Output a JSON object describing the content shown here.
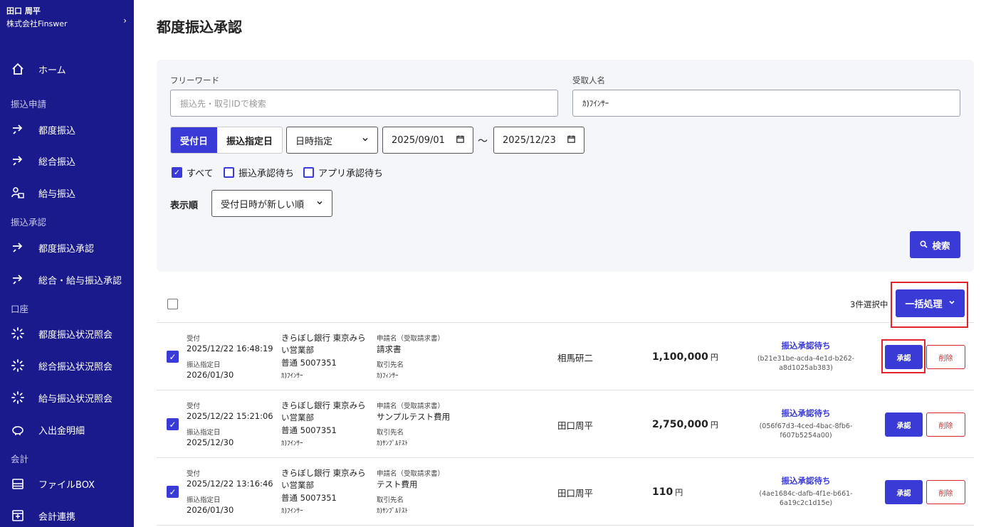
{
  "sidebar": {
    "user_name": "田口 周平",
    "company": "株式会社Finswer",
    "home": "ホーム",
    "section_transfer": "振込申請",
    "item_single": "都度振込",
    "item_bulk": "総合振込",
    "item_salary": "給与振込",
    "section_approval": "振込承認",
    "item_single_approval": "都度振込承認",
    "item_bulk_salary_approval": "総合・給与振込承認",
    "section_account": "口座",
    "item_single_status": "都度振込状況照会",
    "item_bulk_status": "総合振込状況照会",
    "item_salary_status": "給与振込状況照会",
    "item_statement": "入出金明細",
    "section_accounting": "会計",
    "item_filebox": "ファイルBOX",
    "item_accounting_link": "会計連携"
  },
  "page_title": "都度振込承認",
  "filter": {
    "freeword_label": "フリーワード",
    "freeword_placeholder": "振込先・取引IDで検索",
    "recipient_label": "受取人名",
    "recipient_value": "ｶ)ﾌｲﾝｻｰ",
    "seg_received": "受付日",
    "seg_designated": "振込指定日",
    "period_select": "日時指定",
    "date_from": "2025/09/01",
    "tilde": "〜",
    "date_to": "2025/12/23",
    "cb_all": "すべて",
    "cb_transfer_wait": "振込承認待ち",
    "cb_app_wait": "アプリ承認待ち",
    "sort_label": "表示順",
    "sort_value": "受付日時が新しい順",
    "search_button": "検索"
  },
  "list": {
    "selected_count": "3件選択中",
    "bulk_button": "一括処理",
    "rows": [
      {
        "received_label": "受付",
        "received": "2025/12/22 16:48:19",
        "designated_label": "振込指定日",
        "designated": "2026/01/30",
        "bank_line1": "きらぼし銀行 東京みら",
        "bank_line2": "い営業部",
        "account": "普通 5007351",
        "account_name": "ｶ)ﾌｲﾝｻｰ",
        "request_label": "申請名（受取請求書）",
        "request": "請求書",
        "partner_label": "取引先名",
        "partner": "ｶ)ﾌｨﾝｻｰ",
        "applicant": "相馬研二",
        "amount": "1,100,000",
        "yen": "円",
        "status": "振込承認待ち",
        "txid": "(b21e31be-acda-4e1d-b262-a8d1025ab383)",
        "approve": "承認",
        "delete": "削除"
      },
      {
        "received_label": "受付",
        "received": "2025/12/22 15:21:06",
        "designated_label": "振込指定日",
        "designated": "2025/12/30",
        "bank_line1": "きらぼし銀行 東京みら",
        "bank_line2": "い営業部",
        "account": "普通 5007351",
        "account_name": "ｶ)ﾌｲﾝｻｰ",
        "request_label": "申請名（受取請求書）",
        "request": "サンプルテスト費用",
        "partner_label": "取引先名",
        "partner": "ｶ)ｻﾝﾌﾟﾙﾃｽﾄ",
        "applicant": "田口周平",
        "amount": "2,750,000",
        "yen": "円",
        "status": "振込承認待ち",
        "txid": "(056f67d3-4ced-4bac-8fb6-f607b5254a00)",
        "approve": "承認",
        "delete": "削除"
      },
      {
        "received_label": "受付",
        "received": "2025/12/22 13:16:46",
        "designated_label": "振込指定日",
        "designated": "2026/01/30",
        "bank_line1": "きらぼし銀行 東京みら",
        "bank_line2": "い営業部",
        "account": "普通 5007351",
        "account_name": "ｶ)ﾌｲﾝｻｰ",
        "request_label": "申請名（受取請求書）",
        "request": "テスト費用",
        "partner_label": "取引先名",
        "partner": "ｶ)ｻﾝﾌﾟﾙﾃｽﾄ",
        "applicant": "田口周平",
        "amount": "110",
        "yen": "円",
        "status": "振込承認待ち",
        "txid": "(4ae1684c-dafb-4f1e-b661-6a19c2c1d15e)",
        "approve": "承認",
        "delete": "削除"
      }
    ]
  }
}
